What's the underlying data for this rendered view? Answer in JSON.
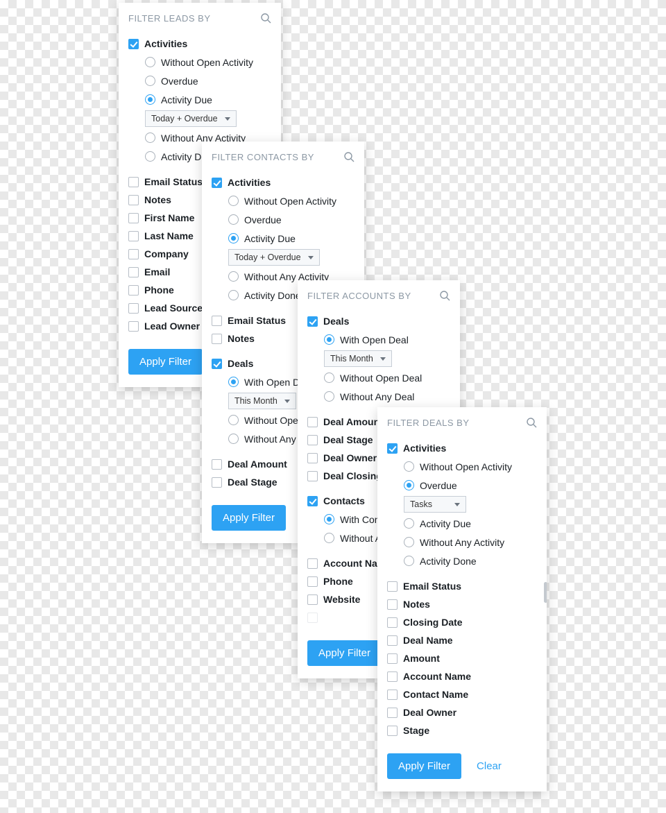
{
  "buttons": {
    "apply": "Apply Filter",
    "clear": "Clear"
  },
  "dropdowns": {
    "today_overdue": "Today + Overdue",
    "this_month": "This Month",
    "tasks": "Tasks"
  },
  "leads": {
    "title": "FILTER LEADS BY",
    "activities": "Activities",
    "opts": [
      "Without Open Activity",
      "Overdue",
      "Activity Due",
      "Without Any Activity",
      "Activity Done"
    ],
    "fields": [
      "Email Status",
      "Notes",
      "First Name",
      "Last Name",
      "Company",
      "Email",
      "Phone",
      "Lead Source",
      "Lead Owner"
    ]
  },
  "contacts": {
    "title": "FILTER CONTACTS BY",
    "activities": "Activities",
    "opts": [
      "Without Open Activity",
      "Overdue",
      "Activity Due",
      "Without Any Activity",
      "Activity Done"
    ],
    "field_email": "Email Status",
    "field_notes": "Notes",
    "deals": "Deals",
    "deal_opts": [
      "With Open Deal",
      "Without Open Deal",
      "Without Any Deal"
    ],
    "field_amount": "Deal Amount",
    "field_stage": "Deal Stage"
  },
  "accounts": {
    "title": "FILTER ACCOUNTS BY",
    "deals": "Deals",
    "deal_opts": [
      "With Open Deal",
      "Without Open Deal",
      "Without Any Deal"
    ],
    "field_amount": "Deal Amount",
    "field_stage": "Deal Stage",
    "field_owner": "Deal Owner",
    "field_closing": "Deal Closing Date",
    "contacts": "Contacts",
    "contact_opts": [
      "With Contacts",
      "Without Any Contact"
    ],
    "field_accname": "Account Name",
    "field_phone": "Phone",
    "field_website": "Website"
  },
  "dealspanel": {
    "title": "FILTER DEALS BY",
    "activities": "Activities",
    "opts": [
      "Without Open Activity",
      "Overdue",
      "Activity Due",
      "Without Any Activity",
      "Activity Done"
    ],
    "fields": [
      "Email Status",
      "Notes",
      "Closing Date",
      "Deal Name",
      "Amount",
      "Account Name",
      "Contact Name",
      "Deal Owner",
      "Stage"
    ]
  }
}
